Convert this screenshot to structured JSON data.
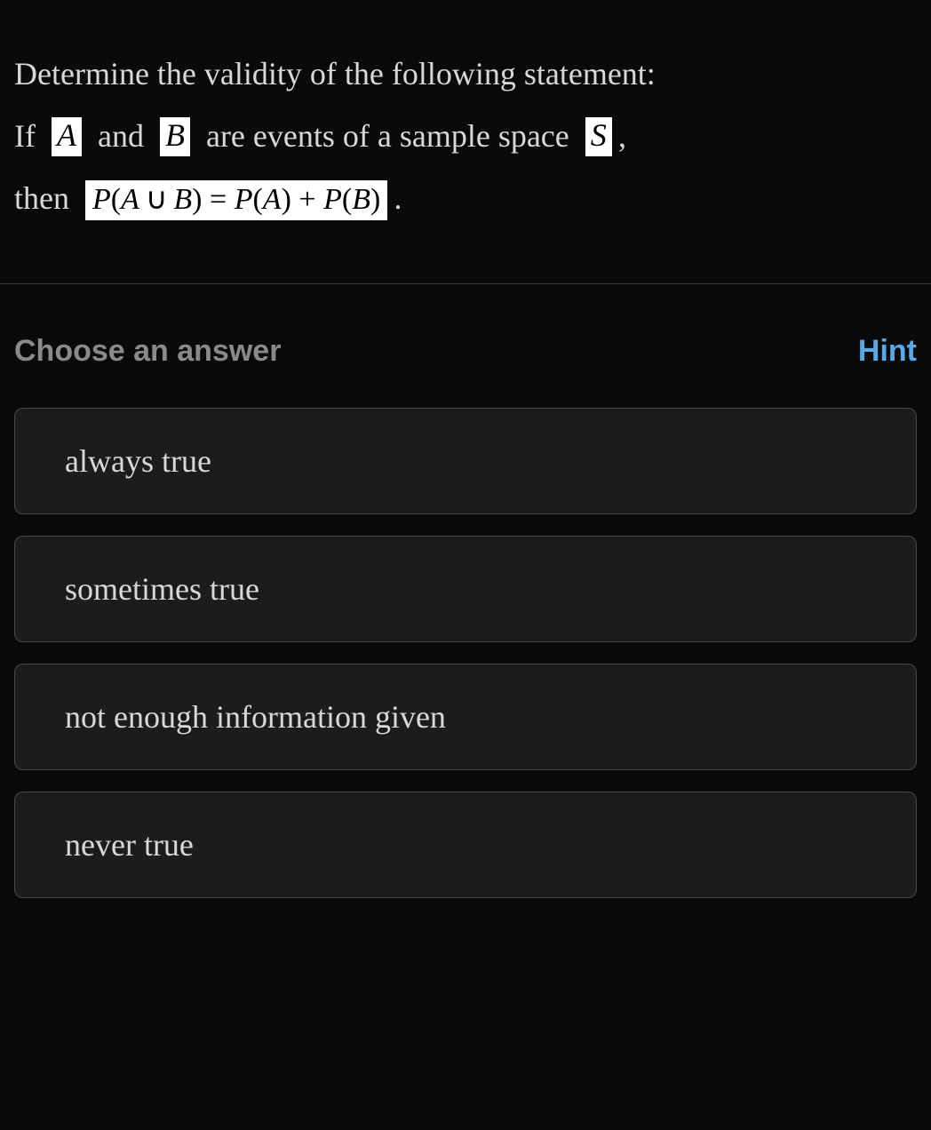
{
  "question": {
    "intro": "Determine the validity of the following statement:",
    "if": "If",
    "and": "and",
    "are_events": "are events of a sample space",
    "comma": ",",
    "then": "then",
    "period": ".",
    "varA": "A",
    "varB": "B",
    "varS": "S",
    "equation": {
      "P1": "P",
      "open1": "(",
      "A": "A",
      "union": "∪",
      "B1": "B",
      "close1": ")",
      "eq": "=",
      "P2": "P",
      "open2": "(",
      "A2": "A",
      "close2": ")",
      "plus": "+",
      "P3": "P",
      "open3": "(",
      "B2": "B",
      "close3": ")"
    }
  },
  "answer_header": {
    "choose": "Choose an answer",
    "hint": "Hint"
  },
  "options": [
    "always true",
    "sometimes true",
    "not enough information given",
    "never true"
  ]
}
